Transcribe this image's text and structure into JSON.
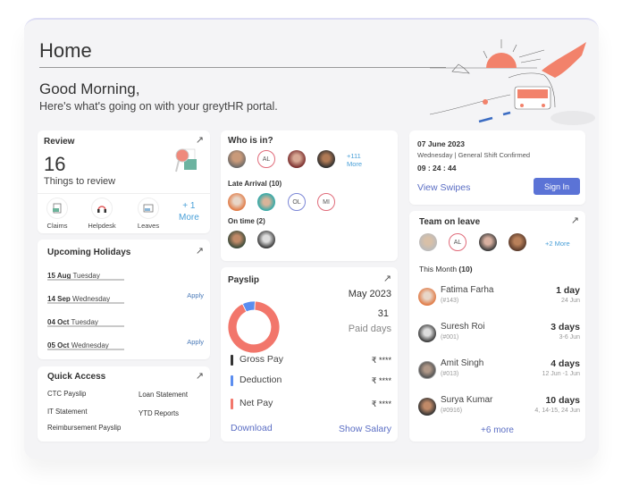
{
  "header": {
    "title": "Home",
    "greeting": "Good Morning,",
    "subtitle": "Here's what's going on with your greytHR portal."
  },
  "review": {
    "title": "Review",
    "count": "16",
    "subtitle": "Things to review",
    "actions": [
      {
        "label": "Claims",
        "icon": "claims-icon"
      },
      {
        "label": "Helpdesk",
        "icon": "headset-icon"
      },
      {
        "label": "Leaves",
        "icon": "leaves-icon"
      }
    ],
    "more_top": "+ 1",
    "more_bottom": "More"
  },
  "holidays": {
    "title": "Upcoming Holidays",
    "items": [
      {
        "date": "15 Aug",
        "day": "Tuesday",
        "apply": ""
      },
      {
        "date": "14 Sep",
        "day": "Wednesday",
        "apply": "Apply"
      },
      {
        "date": "04 Oct",
        "day": "Tuesday",
        "apply": ""
      },
      {
        "date": "05 Oct",
        "day": "Wednesday",
        "apply": "Apply"
      }
    ]
  },
  "quick_access": {
    "title": "Quick Access",
    "links": [
      "CTC Payslip",
      "Loan Statement",
      "IT Statement",
      "YTD Reports",
      "Reimbursement Payslip"
    ]
  },
  "who_is_in": {
    "title": "Who is in?",
    "present_initials": "AL",
    "present_more_top": "+111",
    "present_more_bottom": "More",
    "late_title": "Late Arrival (10)",
    "late_initials": [
      "OL",
      "MI"
    ],
    "ontime_title": "On time (2)"
  },
  "payslip": {
    "title": "Payslip",
    "month": "May 2023",
    "paid_days": "31",
    "paid_days_label": "Paid days",
    "rows": [
      {
        "label": "Gross Pay",
        "value": "₹ ****",
        "color": "#333333"
      },
      {
        "label": "Deduction",
        "value": "₹ ****",
        "color": "#5b8def"
      },
      {
        "label": "Net Pay",
        "value": "₹ ****",
        "color": "#f2766b"
      }
    ],
    "donut": {
      "deduction_fraction": 0.08,
      "net_fraction": 0.92
    },
    "download_label": "Download",
    "show_salary_label": "Show Salary"
  },
  "attendance": {
    "date": "07 June 2023",
    "shift": "Wednesday | General Shift Confirmed",
    "time": "09 : 24 : 44",
    "view_swipes": "View Swipes",
    "sign_in": "Sign In"
  },
  "team_on_leave": {
    "title": "Team on leave",
    "initials": "AL",
    "more": "+2 More",
    "month_label": "This Month",
    "month_count": "(10)",
    "members": [
      {
        "name": "Fatima Farha",
        "id": "(#143)",
        "days": "1 day",
        "dates": "24 Jun"
      },
      {
        "name": "Suresh Roi",
        "id": "(#001)",
        "days": "3 days",
        "dates": "3-6 Jun"
      },
      {
        "name": "Amit Singh",
        "id": "(#013)",
        "days": "4 days",
        "dates": "12 Jun -1 Jun"
      },
      {
        "name": "Surya Kumar",
        "id": "(#0916)",
        "days": "10 days",
        "dates": "4, 14-15, 24 Jun"
      }
    ],
    "more_link": "+6 more"
  },
  "colors": {
    "accent": "#5b73d6",
    "link": "#5b6ec4",
    "net_pay": "#f2766b",
    "deduction": "#5b8def"
  }
}
